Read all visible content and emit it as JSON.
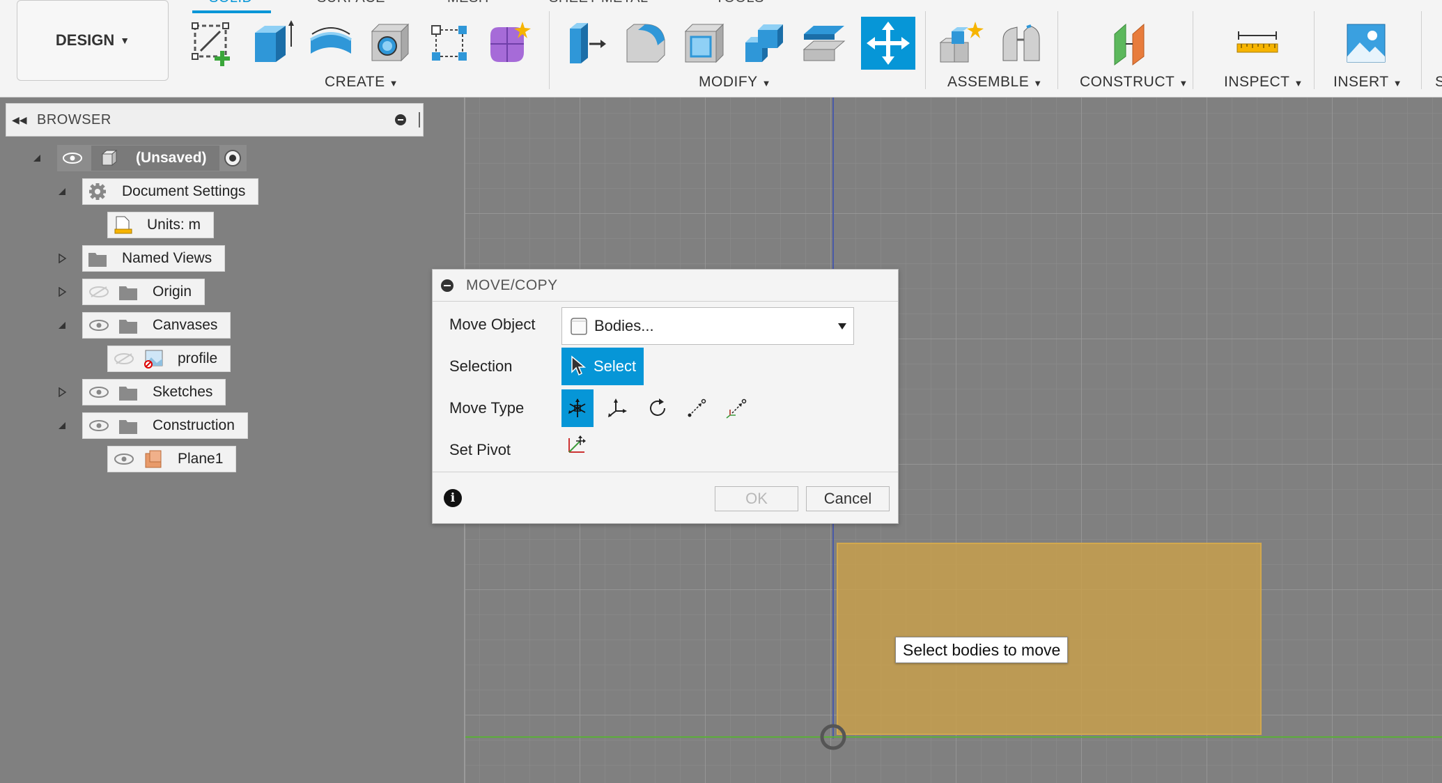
{
  "workspace": {
    "label": "DESIGN"
  },
  "tabs": [
    {
      "label": "SOLID",
      "active": true
    },
    {
      "label": "SURFACE",
      "active": false
    },
    {
      "label": "MESH",
      "active": false
    },
    {
      "label": "SHEET METAL",
      "active": false
    },
    {
      "label": "TOOLS",
      "active": false
    }
  ],
  "tool_groups": [
    {
      "label": "CREATE",
      "tools": [
        "create-sketch-icon",
        "extrude-icon",
        "revolve-icon",
        "hole-icon",
        "rectangular-pattern-icon",
        "create-form-icon"
      ]
    },
    {
      "label": "MODIFY",
      "tools": [
        "press-pull-icon",
        "fillet-icon",
        "shell-icon",
        "combine-icon",
        "offset-face-icon",
        "move-copy-icon"
      ]
    },
    {
      "label": "ASSEMBLE",
      "tools": [
        "new-component-icon",
        "joint-icon"
      ]
    },
    {
      "label": "CONSTRUCT",
      "tools": [
        "offset-plane-icon"
      ]
    },
    {
      "label": "INSPECT",
      "tools": [
        "measure-icon"
      ]
    },
    {
      "label": "INSERT",
      "tools": [
        "insert-canvas-icon"
      ]
    },
    {
      "label": "S",
      "tools": []
    }
  ],
  "accent_color": "#0696d7",
  "browser": {
    "title": "BROWSER",
    "root": {
      "label": "(Unsaved)"
    },
    "items": [
      {
        "label": "Document Settings"
      },
      {
        "label": "Units: m"
      },
      {
        "label": "Named Views"
      },
      {
        "label": "Origin"
      },
      {
        "label": "Canvases"
      },
      {
        "label": "profile"
      },
      {
        "label": "Sketches"
      },
      {
        "label": "Construction"
      },
      {
        "label": "Plane1"
      }
    ]
  },
  "dialog": {
    "title": "MOVE/COPY",
    "move_object_label": "Move Object",
    "move_object_value": "Bodies...",
    "selection_label": "Selection",
    "select_button": "Select",
    "move_type_label": "Move Type",
    "move_types": [
      "free-move-icon",
      "translate-icon",
      "rotate-icon",
      "point-to-point-icon",
      "point-to-position-icon"
    ],
    "set_pivot_label": "Set Pivot",
    "ok_label": "OK",
    "cancel_label": "Cancel"
  },
  "tooltip": "Select bodies to move"
}
